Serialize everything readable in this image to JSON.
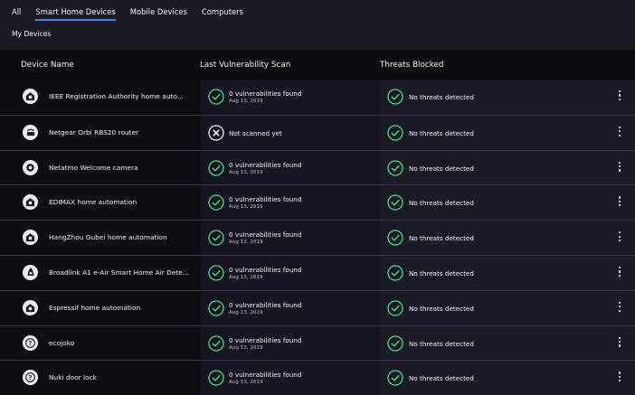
{
  "tabs": [
    "All",
    "Smart Home Devices",
    "Mobile Devices",
    "Computers"
  ],
  "active_tab": 1,
  "section_label": "My Devices",
  "columns": {
    "name": "Device Name",
    "scan": "Last Vulnerability Scan",
    "threats": "Threats Blocked"
  },
  "colors": {
    "ok": "#4ade80",
    "accent": "#3b82f6"
  },
  "devices": [
    {
      "name": "IEEE Registration Authority home auto...",
      "icon": "home-automation-icon",
      "scan_status": "ok",
      "scan_text": "0 vulnerabilities found",
      "scan_date": "Aug 13, 2019",
      "threats": "No threats detected"
    },
    {
      "name": "Netgear Orbi RBS20 router",
      "icon": "router-icon",
      "scan_status": "none",
      "scan_text": "Not scanned yet",
      "scan_date": "",
      "threats": "No threats detected"
    },
    {
      "name": "Netatmo Welcome camera",
      "icon": "camera-icon",
      "scan_status": "ok",
      "scan_text": "0 vulnerabilities found",
      "scan_date": "Aug 13, 2019",
      "threats": "No threats detected"
    },
    {
      "name": "EDIMAX home automation",
      "icon": "home-automation-icon",
      "scan_status": "ok",
      "scan_text": "0 vulnerabilities found",
      "scan_date": "Aug 13, 2019",
      "threats": "No threats detected"
    },
    {
      "name": "HangZhou Gubei home automation",
      "icon": "home-automation-icon",
      "scan_status": "ok",
      "scan_text": "0 vulnerabilities found",
      "scan_date": "Aug 13, 2019",
      "threats": "No threats detected"
    },
    {
      "name": "Broadlink A1 e-Air Smart Home Air Dete...",
      "icon": "air-detector-icon",
      "scan_status": "ok",
      "scan_text": "0 vulnerabilities found",
      "scan_date": "Aug 13, 2019",
      "threats": "No threats detected"
    },
    {
      "name": "Espressif home automation",
      "icon": "home-automation-icon",
      "scan_status": "ok",
      "scan_text": "0 vulnerabilities found",
      "scan_date": "Aug 13, 2019",
      "threats": "No threats detected"
    },
    {
      "name": "ecojoko",
      "icon": "unknown-device-icon",
      "scan_status": "ok",
      "scan_text": "0 vulnerabilities found",
      "scan_date": "Aug 13, 2019",
      "threats": "No threats detected"
    },
    {
      "name": "Nuki door lock",
      "icon": "unknown-device-icon",
      "scan_status": "ok",
      "scan_text": "0 vulnerabilities found",
      "scan_date": "Aug 13, 2019",
      "threats": "No threats detected"
    }
  ]
}
